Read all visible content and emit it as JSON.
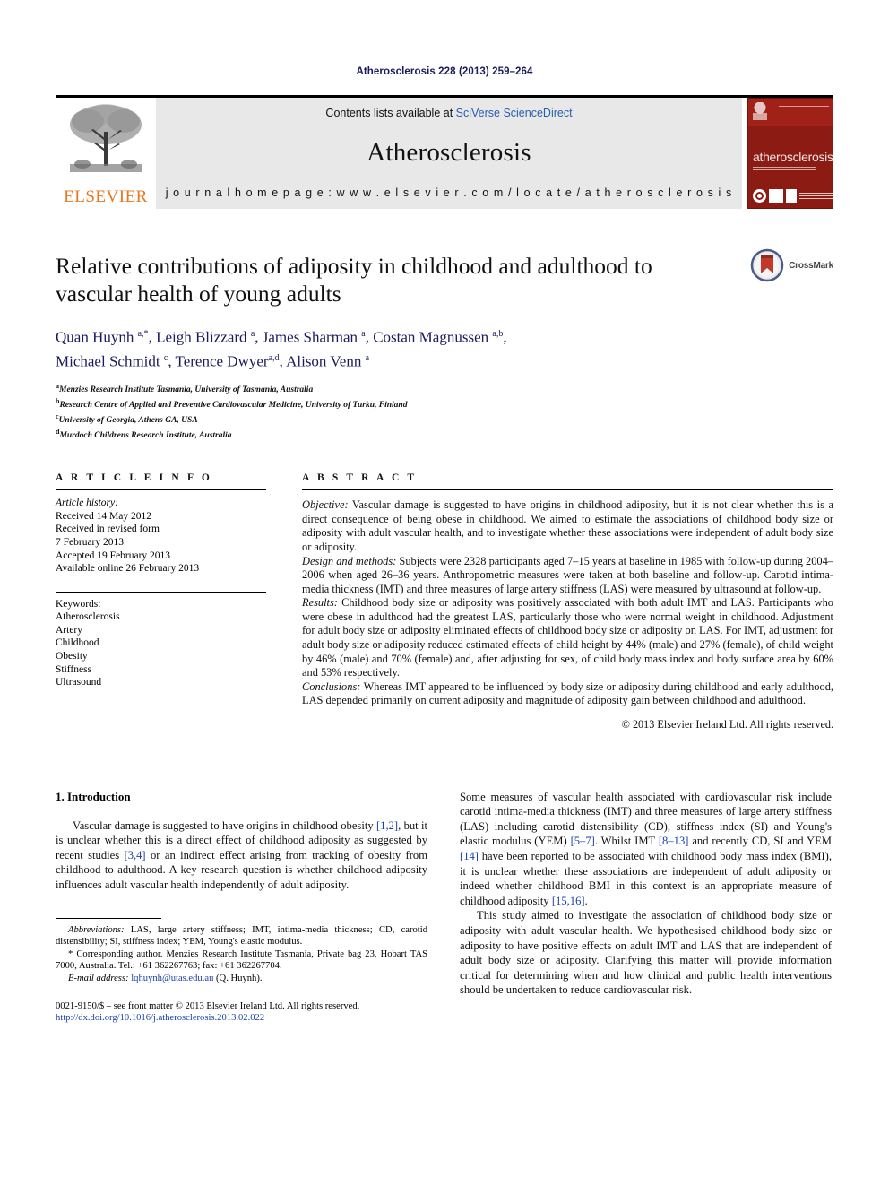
{
  "running_head": "Atherosclerosis 228 (2013) 259–264",
  "masthead": {
    "publisher_name": "ELSEVIER",
    "contents_prefix": "Contents lists available at ",
    "contents_link": "SciVerse ScienceDirect",
    "journal_name": "Atherosclerosis",
    "homepage_line": "j o u r n a l    h o m e p a g e :   w w w . e l s e v i e r . c o m / l o c a t e / a t h e r o s c l e r o s i s",
    "cover_title": "atherosclerosis"
  },
  "article": {
    "title": "Relative contributions of adiposity in childhood and adulthood to vascular health of young adults",
    "crossmark_label": "CrossMark",
    "authors_html": "Quan Huynh a,*, Leigh Blizzard a, James Sharman a, Costan Magnussen a,b, Michael Schmidt c, Terence Dwyer a,d, Alison Venn a",
    "affiliations": [
      {
        "marker": "a",
        "text": "Menzies Research Institute Tasmania, University of Tasmania, Australia"
      },
      {
        "marker": "b",
        "text": "Research Centre of Applied and Preventive Cardiovascular Medicine, University of Turku, Finland"
      },
      {
        "marker": "c",
        "text": "University of Georgia, Athens GA, USA"
      },
      {
        "marker": "d",
        "text": "Murdoch Childrens Research Institute, Australia"
      }
    ]
  },
  "article_info": {
    "heading": "A R T I C L E   I N F O",
    "history_label": "Article history:",
    "history_lines": [
      "Received 14 May 2012",
      "Received in revised form",
      "7 February 2013",
      "Accepted 19 February 2013",
      "Available online 26 February 2013"
    ],
    "keywords_label": "Keywords:",
    "keywords": [
      "Atherosclerosis",
      "Artery",
      "Childhood",
      "Obesity",
      "Stiffness",
      "Ultrasound"
    ]
  },
  "abstract": {
    "heading": "A B S T R A C T",
    "objective_label": "Objective:",
    "objective_text": " Vascular damage is suggested to have origins in childhood adiposity, but it is not clear whether this is a direct consequence of being obese in childhood. We aimed to estimate the associations of childhood body size or adiposity with adult vascular health, and to investigate whether these associations were independent of adult body size or adiposity.",
    "design_label": "Design and methods:",
    "design_text": " Subjects were 2328 participants aged 7–15 years at baseline in 1985 with follow-up during 2004–2006 when aged 26–36 years. Anthropometric measures were taken at both baseline and follow-up. Carotid intima-media thickness (IMT) and three measures of large artery stiffness (LAS) were measured by ultrasound at follow-up.",
    "results_label": "Results:",
    "results_text": " Childhood body size or adiposity was positively associated with both adult IMT and LAS. Participants who were obese in adulthood had the greatest LAS, particularly those who were normal weight in childhood. Adjustment for adult body size or adiposity eliminated effects of childhood body size or adiposity on LAS. For IMT, adjustment for adult body size or adiposity reduced estimated effects of child height by 44% (male) and 27% (female), of child weight by 46% (male) and 70% (female) and, after adjusting for sex, of child body mass index and body surface area by 60% and 53% respectively.",
    "conclusions_label": "Conclusions:",
    "conclusions_text": " Whereas IMT appeared to be influenced by body size or adiposity during childhood and early adulthood, LAS depended primarily on current adiposity and magnitude of adiposity gain between childhood and adulthood.",
    "copyright": "© 2013 Elsevier Ireland Ltd. All rights reserved."
  },
  "introduction": {
    "heading": "1.  Introduction",
    "left_paragraph_1": "Vascular damage is suggested to have origins in childhood obesity [1,2], but it is unclear whether this is a direct effect of childhood adiposity as suggested by recent studies [3,4] or an indirect effect arising from tracking of obesity from childhood to adulthood. A key research question is whether childhood adiposity influences adult vascular health independently of adult adiposity.",
    "right_paragraph_1": "Some measures of vascular health associated with cardiovascular risk include carotid intima-media thickness (IMT) and three measures of large artery stiffness (LAS) including carotid distensibility (CD), stiffness index (SI) and Young's elastic modulus (YEM) [5–7]. Whilst IMT [8–13] and recently CD, SI and YEM [14] have been reported to be associated with childhood body mass index (BMI), it is unclear whether these associations are independent of adult adiposity or indeed whether childhood BMI in this context is an appropriate measure of childhood adiposity [15,16].",
    "right_paragraph_2": "This study aimed to investigate the association of childhood body size or adiposity with adult vascular health. We hypothesised childhood body size or adiposity to have positive effects on adult IMT and LAS that are independent of adult body size or adiposity. Clarifying this matter will provide information critical for determining when and how clinical and public health interventions should be undertaken to reduce cardiovascular risk."
  },
  "footnotes": {
    "abbreviations_label": "Abbreviations:",
    "abbreviations_text": " LAS, large artery stiffness; IMT, intima-media thickness; CD, carotid distensibility; SI, stiffness index; YEM, Young's elastic modulus.",
    "corresponding_text": "* Corresponding author. Menzies Research Institute Tasmania, Private bag 23, Hobart TAS 7000, Australia. Tel.: +61 362267763; fax: +61 362267704.",
    "email_label": "E-mail address:",
    "email_link": "lqhuynh@utas.edu.au",
    "email_suffix": " (Q. Huynh).",
    "issn_line": "0021-9150/$ – see front matter © 2013 Elsevier Ireland Ltd. All rights reserved.",
    "doi_line": "http://dx.doi.org/10.1016/j.atherosclerosis.2013.02.022"
  },
  "colors": {
    "link_blue": "#2a5db0",
    "ref_blue": "#1a3faa",
    "author_navy": "#1a1a5e",
    "elsevier_orange": "#E87722",
    "cover_red": "#8c1c13"
  }
}
